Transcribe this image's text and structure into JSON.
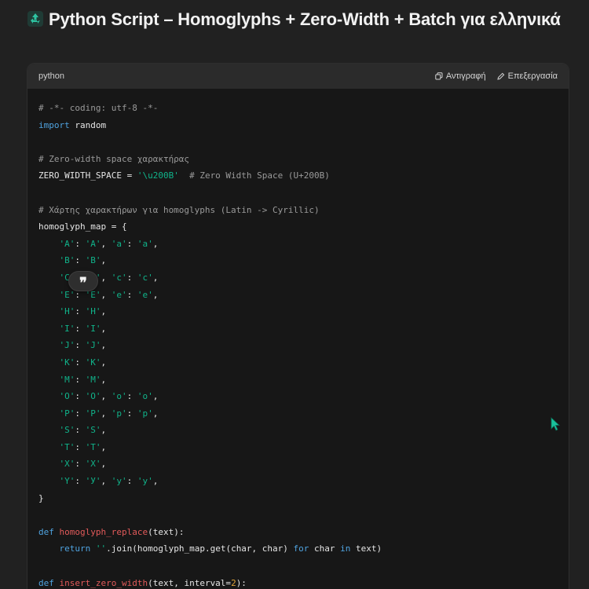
{
  "heading": {
    "title": "Python Script – Homoglyphs + Zero-Width + Batch για ελληνικά"
  },
  "code_block": {
    "language": "python",
    "copy_label": "Αντιγραφή",
    "edit_label": "Επεξεργασία",
    "lines": [
      [
        [
          "comment",
          "# -*- coding: utf-8 -*-"
        ]
      ],
      [
        [
          "kw",
          "import"
        ],
        [
          "plain",
          " random"
        ]
      ],
      [],
      [
        [
          "comment",
          "# Zero-width space χαρακτήρας"
        ]
      ],
      [
        [
          "plain",
          "ZERO_WIDTH_SPACE = "
        ],
        [
          "str",
          "'\\u200B'"
        ],
        [
          "comment",
          "  # Zero Width Space (U+200B)"
        ]
      ],
      [],
      [
        [
          "comment",
          "# Χάρτης χαρακτήρων για homoglyphs (Latin -> Cyrillic)"
        ]
      ],
      [
        [
          "plain",
          "homoglyph_map = {"
        ]
      ],
      [
        [
          "plain",
          "    "
        ],
        [
          "str",
          "'A'"
        ],
        [
          "plain",
          ": "
        ],
        [
          "str",
          "'А'"
        ],
        [
          "plain",
          ", "
        ],
        [
          "str",
          "'a'"
        ],
        [
          "plain",
          ": "
        ],
        [
          "str",
          "'а'"
        ],
        [
          "plain",
          ","
        ]
      ],
      [
        [
          "plain",
          "    "
        ],
        [
          "str",
          "'B'"
        ],
        [
          "plain",
          ": "
        ],
        [
          "str",
          "'В'"
        ],
        [
          "plain",
          ","
        ]
      ],
      [
        [
          "plain",
          "    "
        ],
        [
          "str",
          "'C'"
        ],
        [
          "plain",
          ": "
        ],
        [
          "str",
          "'С'"
        ],
        [
          "plain",
          ", "
        ],
        [
          "str",
          "'c'"
        ],
        [
          "plain",
          ": "
        ],
        [
          "str",
          "'с'"
        ],
        [
          "plain",
          ","
        ]
      ],
      [
        [
          "plain",
          "    "
        ],
        [
          "str",
          "'E'"
        ],
        [
          "plain",
          ": "
        ],
        [
          "str",
          "'Е'"
        ],
        [
          "plain",
          ", "
        ],
        [
          "str",
          "'e'"
        ],
        [
          "plain",
          ": "
        ],
        [
          "str",
          "'е'"
        ],
        [
          "plain",
          ","
        ]
      ],
      [
        [
          "plain",
          "    "
        ],
        [
          "str",
          "'H'"
        ],
        [
          "plain",
          ": "
        ],
        [
          "str",
          "'Н'"
        ],
        [
          "plain",
          ","
        ]
      ],
      [
        [
          "plain",
          "    "
        ],
        [
          "str",
          "'I'"
        ],
        [
          "plain",
          ": "
        ],
        [
          "str",
          "'І'"
        ],
        [
          "plain",
          ","
        ]
      ],
      [
        [
          "plain",
          "    "
        ],
        [
          "str",
          "'J'"
        ],
        [
          "plain",
          ": "
        ],
        [
          "str",
          "'Ј'"
        ],
        [
          "plain",
          ","
        ]
      ],
      [
        [
          "plain",
          "    "
        ],
        [
          "str",
          "'K'"
        ],
        [
          "plain",
          ": "
        ],
        [
          "str",
          "'К'"
        ],
        [
          "plain",
          ","
        ]
      ],
      [
        [
          "plain",
          "    "
        ],
        [
          "str",
          "'M'"
        ],
        [
          "plain",
          ": "
        ],
        [
          "str",
          "'М'"
        ],
        [
          "plain",
          ","
        ]
      ],
      [
        [
          "plain",
          "    "
        ],
        [
          "str",
          "'O'"
        ],
        [
          "plain",
          ": "
        ],
        [
          "str",
          "'О'"
        ],
        [
          "plain",
          ", "
        ],
        [
          "str",
          "'o'"
        ],
        [
          "plain",
          ": "
        ],
        [
          "str",
          "'о'"
        ],
        [
          "plain",
          ","
        ]
      ],
      [
        [
          "plain",
          "    "
        ],
        [
          "str",
          "'P'"
        ],
        [
          "plain",
          ": "
        ],
        [
          "str",
          "'Р'"
        ],
        [
          "plain",
          ", "
        ],
        [
          "str",
          "'p'"
        ],
        [
          "plain",
          ": "
        ],
        [
          "str",
          "'р'"
        ],
        [
          "plain",
          ","
        ]
      ],
      [
        [
          "plain",
          "    "
        ],
        [
          "str",
          "'S'"
        ],
        [
          "plain",
          ": "
        ],
        [
          "str",
          "'Ѕ'"
        ],
        [
          "plain",
          ","
        ]
      ],
      [
        [
          "plain",
          "    "
        ],
        [
          "str",
          "'T'"
        ],
        [
          "plain",
          ": "
        ],
        [
          "str",
          "'Т'"
        ],
        [
          "plain",
          ","
        ]
      ],
      [
        [
          "plain",
          "    "
        ],
        [
          "str",
          "'X'"
        ],
        [
          "plain",
          ": "
        ],
        [
          "str",
          "'Х'"
        ],
        [
          "plain",
          ","
        ]
      ],
      [
        [
          "plain",
          "    "
        ],
        [
          "str",
          "'Y'"
        ],
        [
          "plain",
          ": "
        ],
        [
          "str",
          "'У'"
        ],
        [
          "plain",
          ", "
        ],
        [
          "str",
          "'y'"
        ],
        [
          "plain",
          ": "
        ],
        [
          "str",
          "'у'"
        ],
        [
          "plain",
          ","
        ]
      ],
      [
        [
          "plain",
          "}"
        ]
      ],
      [],
      [
        [
          "kw",
          "def"
        ],
        [
          "plain",
          " "
        ],
        [
          "fn",
          "homoglyph_replace"
        ],
        [
          "plain",
          "(text):"
        ]
      ],
      [
        [
          "plain",
          "    "
        ],
        [
          "kw",
          "return"
        ],
        [
          "plain",
          " "
        ],
        [
          "str",
          "''"
        ],
        [
          "plain",
          ".join(homoglyph_map.get(char, char) "
        ],
        [
          "kw",
          "for"
        ],
        [
          "plain",
          " char "
        ],
        [
          "kw",
          "in"
        ],
        [
          "plain",
          " text)"
        ]
      ],
      [],
      [
        [
          "kw",
          "def"
        ],
        [
          "plain",
          " "
        ],
        [
          "fn",
          "insert_zero_width"
        ],
        [
          "plain",
          "(text, interval="
        ],
        [
          "num",
          "2"
        ],
        [
          "plain",
          "):"
        ]
      ]
    ]
  },
  "quote_bubble": {
    "glyph": "❞"
  },
  "colors": {
    "background": "#212121",
    "code_background": "#171717",
    "header_background": "#2b2b2b",
    "keyword": "#4fa3e0",
    "string": "#10b38a",
    "function": "#e25a5a",
    "comment": "#9a9a9a",
    "number": "#e0a33a",
    "cursor": "#19c39c"
  },
  "icons": {
    "heading_emoji": "recycle-emoji-icon",
    "copy": "copy-icon",
    "edit": "pencil-icon",
    "cursor": "mouse-pointer-icon"
  }
}
